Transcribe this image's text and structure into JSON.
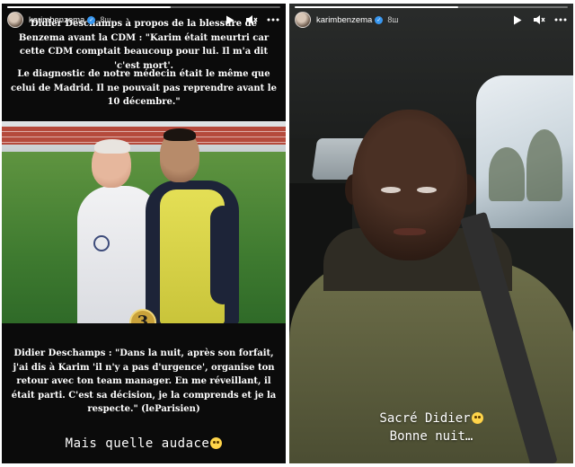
{
  "stories": [
    {
      "username": "karimbenzema",
      "time": "8ш",
      "progress": 0.6,
      "caption_top": "Didier Deschamps à propos de la blessure de Benzema avant la CDM : \"Karim était meurtri car cette CDM comptait beaucoup pour lui. Il m'a dit 'c'est mort'.",
      "caption_mid": "Le diagnostic de notre médecin était le même que celui de Madrid. Il ne pouvait pas reprendre avant le 10 décembre.\"",
      "photo_badge": "3",
      "caption_bottom": "Didier Deschamps : \"Dans la nuit, après son forfait, j'ai dis à Karim 'il n'y a pas d'urgence', organise ton retour avec ton team manager. En me réveillant, il était parti. C'est sa décision, je la comprends et je la respecte.\" (leParisien)",
      "overlay_text": "Mais quelle audace"
    },
    {
      "username": "karimbenzema",
      "time": "8ш",
      "progress": 0.6,
      "overlay_line1": "Sacré Didier",
      "overlay_line2": "Bonne nuit…"
    }
  ],
  "controls": {
    "play_icon": "play-icon",
    "mute_icon": "mute-icon",
    "more_icon": "more-icon"
  },
  "colors": {
    "verified": "#3897f0",
    "bib": "#d8d34a",
    "badge": "#c9a23b"
  }
}
